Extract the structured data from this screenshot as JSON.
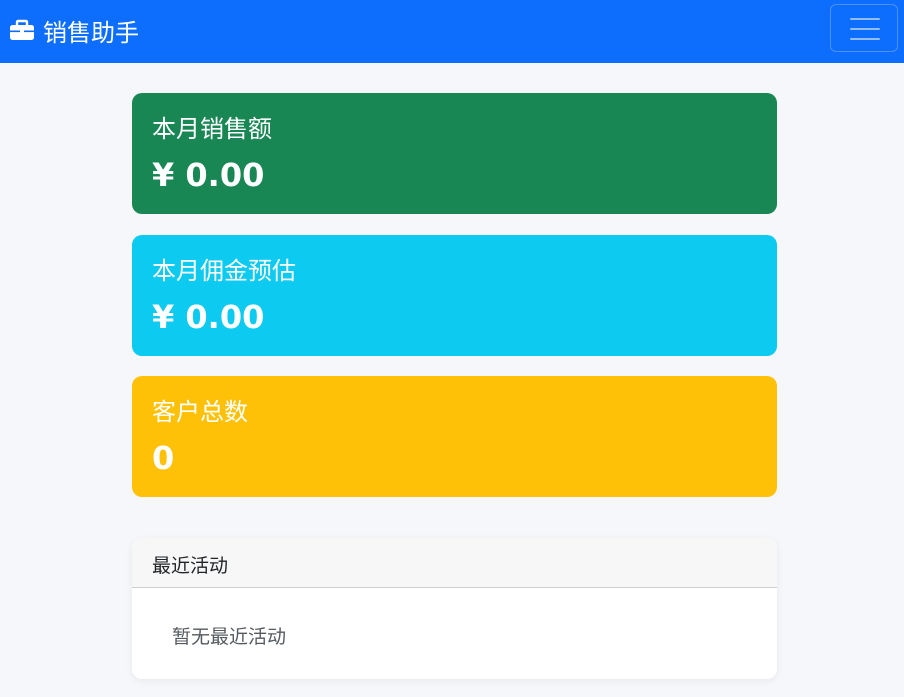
{
  "navbar": {
    "brand_icon": "briefcase-icon",
    "brand_text": "销售助手",
    "toggler_icon": "hamburger-menu-icon",
    "background": "#0d6efd"
  },
  "stats": {
    "sales": {
      "label": "本月销售额",
      "value": "¥ 0.00",
      "color": "#198754"
    },
    "commission": {
      "label": "本月佣金预估",
      "value": "¥ 0.00",
      "color": "#0dcaf0"
    },
    "customers": {
      "label": "客户总数",
      "value": "0",
      "color": "#ffc107"
    }
  },
  "activity": {
    "title": "最近活动",
    "empty_text": "暂无最近活动"
  }
}
